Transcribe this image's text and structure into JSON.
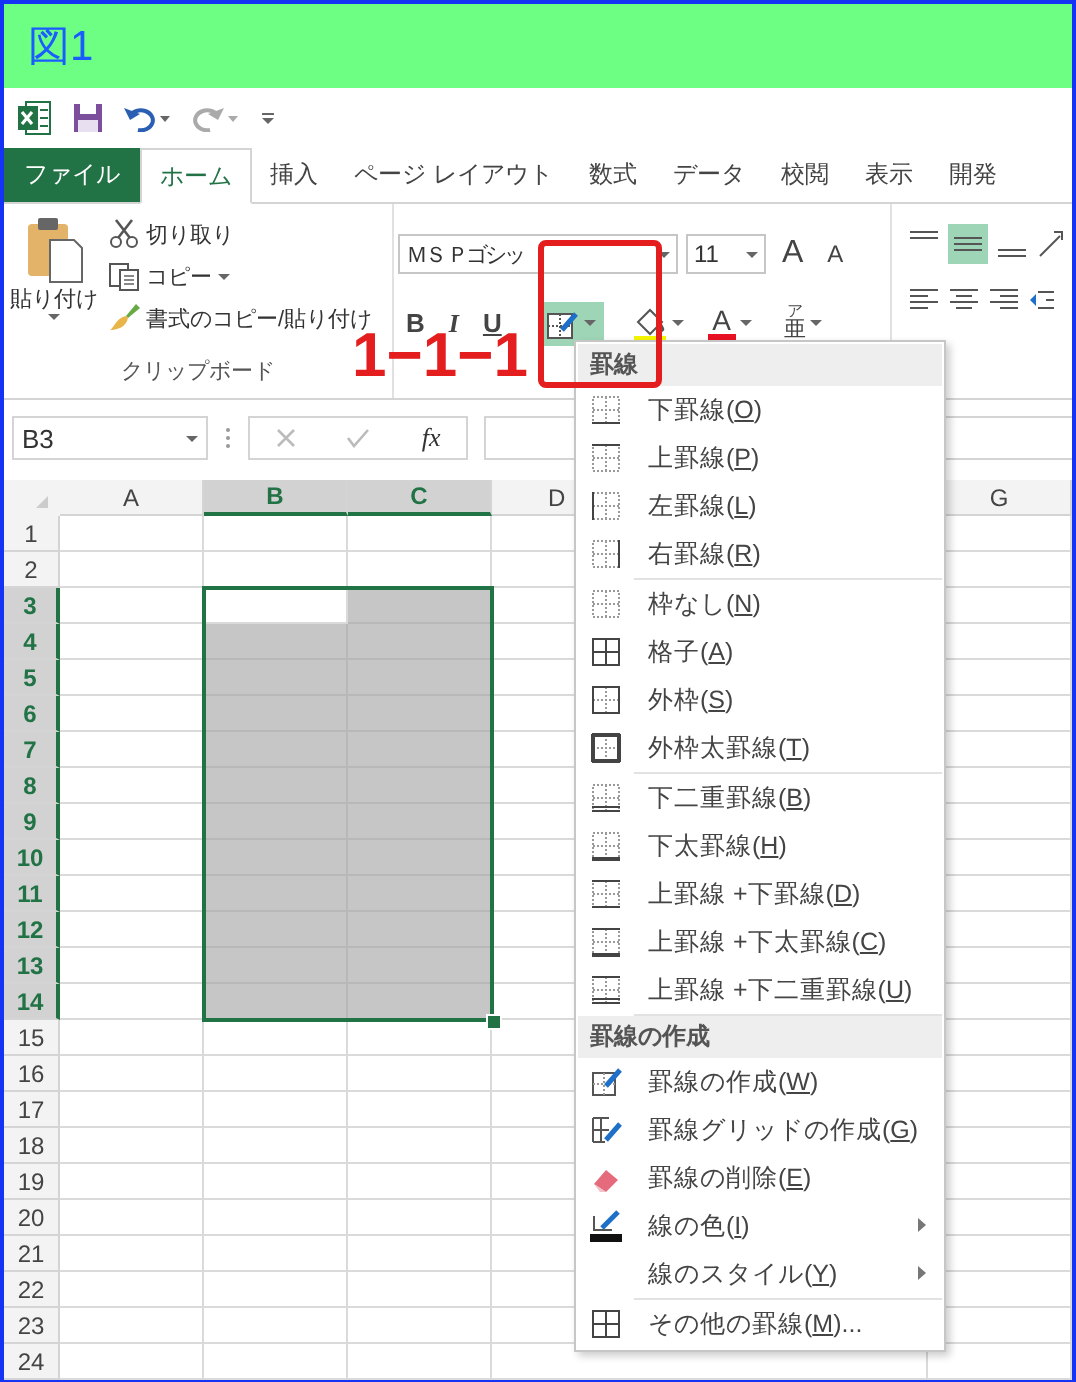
{
  "title": "図1",
  "tabs": [
    {
      "label": "ファイル",
      "kind": "file",
      "selected": false
    },
    {
      "label": "ホーム",
      "kind": "tab",
      "selected": true
    },
    {
      "label": "挿入",
      "kind": "tab",
      "selected": false
    },
    {
      "label": "ページ レイアウト",
      "kind": "tab",
      "selected": false
    },
    {
      "label": "数式",
      "kind": "tab",
      "selected": false
    },
    {
      "label": "データ",
      "kind": "tab",
      "selected": false
    },
    {
      "label": "校閲",
      "kind": "tab",
      "selected": false
    },
    {
      "label": "表示",
      "kind": "tab",
      "selected": false
    },
    {
      "label": "開発",
      "kind": "tab",
      "selected": false
    }
  ],
  "clipboard": {
    "paste": "貼り付け",
    "group_label": "クリップボード",
    "actions": [
      {
        "label": "切り取り",
        "kind": "scissors",
        "dropdown": false
      },
      {
        "label": "コピー",
        "kind": "copy",
        "dropdown": true
      },
      {
        "label": "書式のコピー/貼り付け",
        "kind": "brush",
        "dropdown": false
      }
    ]
  },
  "font": {
    "name": "ＭＳ Ｐゴシッ",
    "size": "11",
    "grow": "A",
    "shrink": "A",
    "styles": [
      {
        "label": "B",
        "kind": "bold"
      },
      {
        "label": "I",
        "kind": "italic"
      },
      {
        "label": "U",
        "kind": "underline"
      }
    ],
    "border_button": {
      "expanded": true
    },
    "font_color": "A",
    "phonetic": {
      "ruby": "ア",
      "base": "亜"
    }
  },
  "formula_bar": {
    "name_box": "B3",
    "function_label": "fx"
  },
  "columns": [
    {
      "label": "A",
      "selected": false,
      "active": false
    },
    {
      "label": "B",
      "selected": true,
      "active": true
    },
    {
      "label": "C",
      "selected": true,
      "active": false
    },
    {
      "label": "D",
      "selected": false,
      "active": false
    },
    {
      "label": "G",
      "selected": false,
      "active": false
    }
  ],
  "rows": [
    {
      "label": "1",
      "selected": false,
      "active": false
    },
    {
      "label": "2",
      "selected": false,
      "active": false
    },
    {
      "label": "3",
      "selected": true,
      "active": true
    },
    {
      "label": "4",
      "selected": true,
      "active": false
    },
    {
      "label": "5",
      "selected": true,
      "active": false
    },
    {
      "label": "6",
      "selected": true,
      "active": false
    },
    {
      "label": "7",
      "selected": true,
      "active": false
    },
    {
      "label": "8",
      "selected": true,
      "active": false
    },
    {
      "label": "9",
      "selected": true,
      "active": false
    },
    {
      "label": "10",
      "selected": true,
      "active": false
    },
    {
      "label": "11",
      "selected": true,
      "active": false
    },
    {
      "label": "12",
      "selected": true,
      "active": false
    },
    {
      "label": "13",
      "selected": true,
      "active": false
    },
    {
      "label": "14",
      "selected": true,
      "active": false
    },
    {
      "label": "15",
      "selected": false,
      "active": false
    },
    {
      "label": "16",
      "selected": false,
      "active": false
    },
    {
      "label": "17",
      "selected": false,
      "active": false
    },
    {
      "label": "18",
      "selected": false,
      "active": false
    },
    {
      "label": "19",
      "selected": false,
      "active": false
    },
    {
      "label": "20",
      "selected": false,
      "active": false
    },
    {
      "label": "21",
      "selected": false,
      "active": false
    },
    {
      "label": "22",
      "selected": false,
      "active": false
    },
    {
      "label": "23",
      "selected": false,
      "active": false
    },
    {
      "label": "24",
      "selected": false,
      "active": false
    }
  ],
  "annotation": {
    "label": "1−1−1"
  },
  "border_menu": {
    "sections": [
      {
        "title": "罫線",
        "groups": [
          [
            {
              "kind": "bottom",
              "text": "下罫線(",
              "key": "O",
              "text_end": ")",
              "submenu": false
            },
            {
              "kind": "top",
              "text": "上罫線(",
              "key": "P",
              "text_end": ")",
              "submenu": false
            },
            {
              "kind": "left",
              "text": "左罫線(",
              "key": "L",
              "text_end": ")",
              "submenu": false
            },
            {
              "kind": "right",
              "text": "右罫線(",
              "key": "R",
              "text_end": ")",
              "submenu": false
            }
          ],
          [
            {
              "kind": "none",
              "text": "枠なし(",
              "key": "N",
              "text_end": ")",
              "submenu": false
            },
            {
              "kind": "all",
              "text": "格子(",
              "key": "A",
              "text_end": ")",
              "submenu": false
            },
            {
              "kind": "outside",
              "text": "外枠(",
              "key": "S",
              "text_end": ")",
              "submenu": false
            },
            {
              "kind": "thick-outside",
              "text": "外枠太罫線(",
              "key": "T",
              "text_end": ")",
              "submenu": false
            }
          ],
          [
            {
              "kind": "bottom-double",
              "text": "下二重罫線(",
              "key": "B",
              "text_end": ")",
              "submenu": false
            },
            {
              "kind": "bottom-thick",
              "text": "下太罫線(",
              "key": "H",
              "text_end": ")",
              "submenu": false
            },
            {
              "kind": "top-bottom",
              "text": "上罫線 +下罫線(",
              "key": "D",
              "text_end": ")",
              "submenu": false
            },
            {
              "kind": "top-thick-bottom",
              "text": "上罫線 +下太罫線(",
              "key": "C",
              "text_end": ")",
              "submenu": false
            },
            {
              "kind": "top-double-bottom",
              "text": "上罫線 +下二重罫線(",
              "key": "U",
              "text_end": ")",
              "submenu": false
            }
          ]
        ]
      },
      {
        "title": "罫線の作成",
        "groups": [
          [
            {
              "kind": "draw",
              "text": "罫線の作成(",
              "key": "W",
              "text_end": ")",
              "submenu": false
            },
            {
              "kind": "draw-grid",
              "text": "罫線グリッドの作成(",
              "key": "G",
              "text_end": ")",
              "submenu": false
            },
            {
              "kind": "erase",
              "text": "罫線の削除(",
              "key": "E",
              "text_end": ")",
              "submenu": false
            },
            {
              "kind": "color",
              "text": "線の色(",
              "key": "I",
              "text_end": ")",
              "submenu": true
            },
            {
              "kind": "blank",
              "text": "線のスタイル(",
              "key": "Y",
              "text_end": ")",
              "submenu": true
            }
          ],
          [
            {
              "kind": "all",
              "text": "その他の罫線(",
              "key": "M",
              "text_end": ")...",
              "submenu": false
            }
          ]
        ]
      }
    ]
  }
}
